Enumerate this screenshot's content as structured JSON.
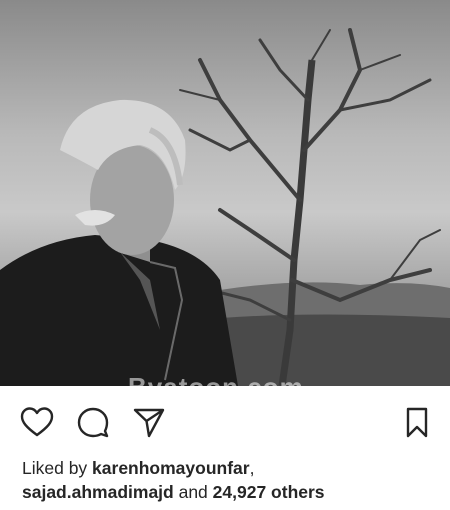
{
  "post": {
    "photo_alt": "Black and white photo of a grey-haired man with a mustache standing beside a bare tree",
    "watermark": "Bvatoon.com"
  },
  "actions": {
    "like_icon": "heart-icon",
    "comment_icon": "comment-bubble-icon",
    "share_icon": "paper-plane-icon",
    "save_icon": "bookmark-icon"
  },
  "likes": {
    "prefix": "Liked by ",
    "user1": "karenhomayounfar",
    "separator": ",",
    "user2": "sajad.ahmadimajd",
    "conjunction": " and ",
    "count": "24,927 others"
  },
  "colors": {
    "text": "#262626",
    "background": "#ffffff"
  }
}
